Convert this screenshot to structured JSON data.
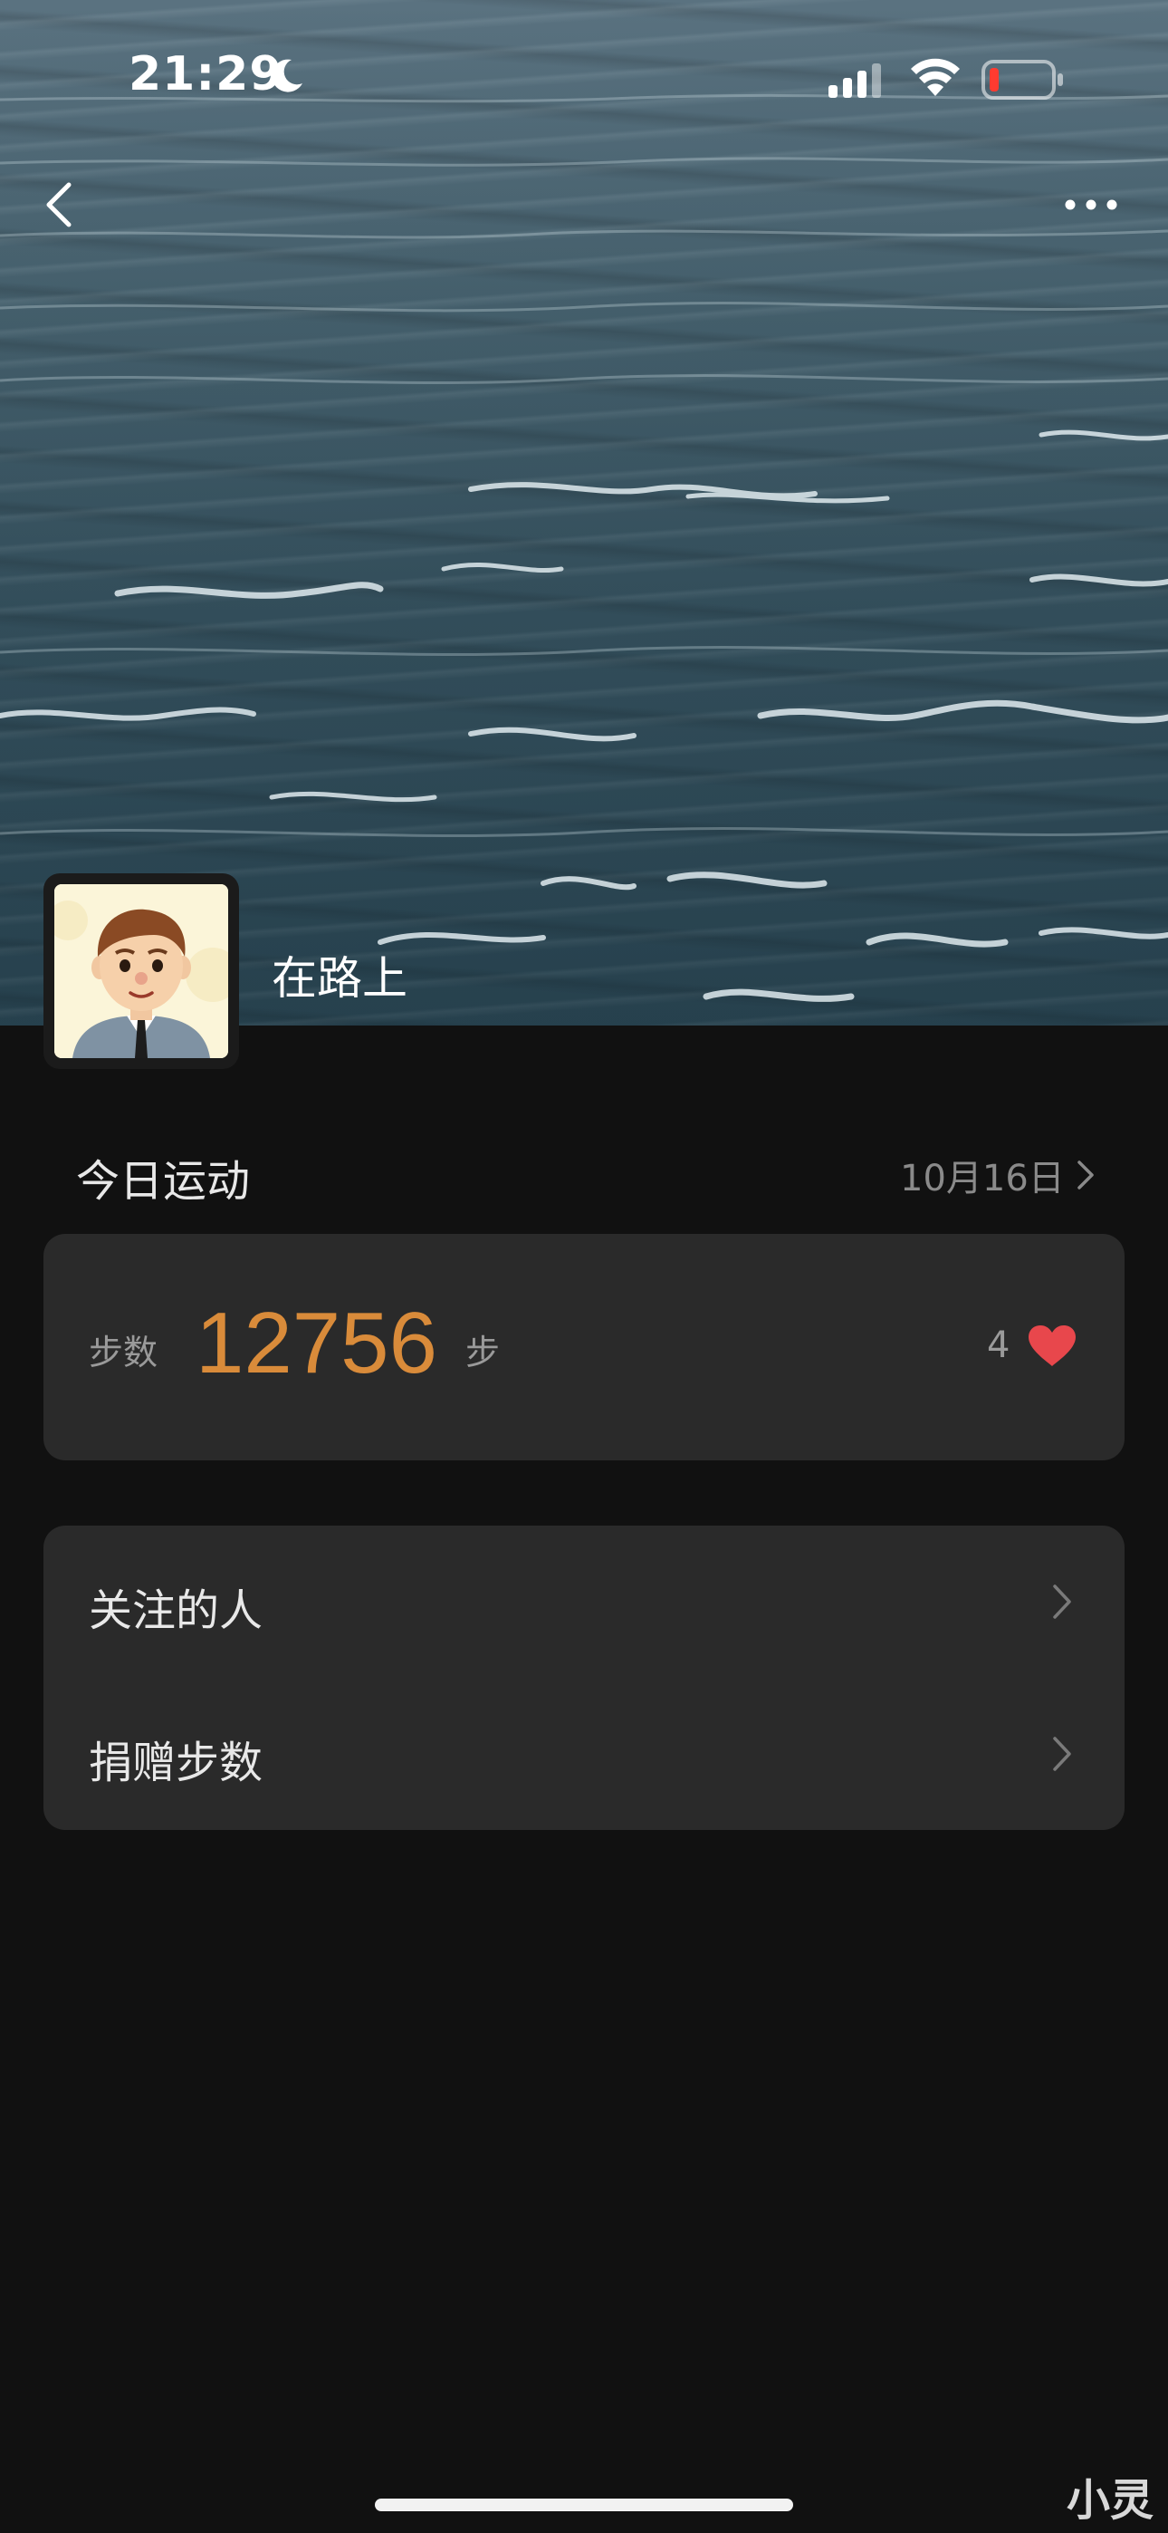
{
  "status_bar": {
    "time": "21:29"
  },
  "profile": {
    "name": "在路上"
  },
  "today": {
    "title": "今日运动",
    "date": "10月16日",
    "steps_label": "步数",
    "steps_value": "12756",
    "steps_unit": "步",
    "likes": "4"
  },
  "menu": [
    {
      "label": "关注的人"
    },
    {
      "label": "捐赠步数"
    }
  ],
  "watermark": "小灵",
  "colors": {
    "accent": "#d98b3a",
    "heart": "#e8474c",
    "background": "#111111",
    "card": "#2a2a2a"
  }
}
